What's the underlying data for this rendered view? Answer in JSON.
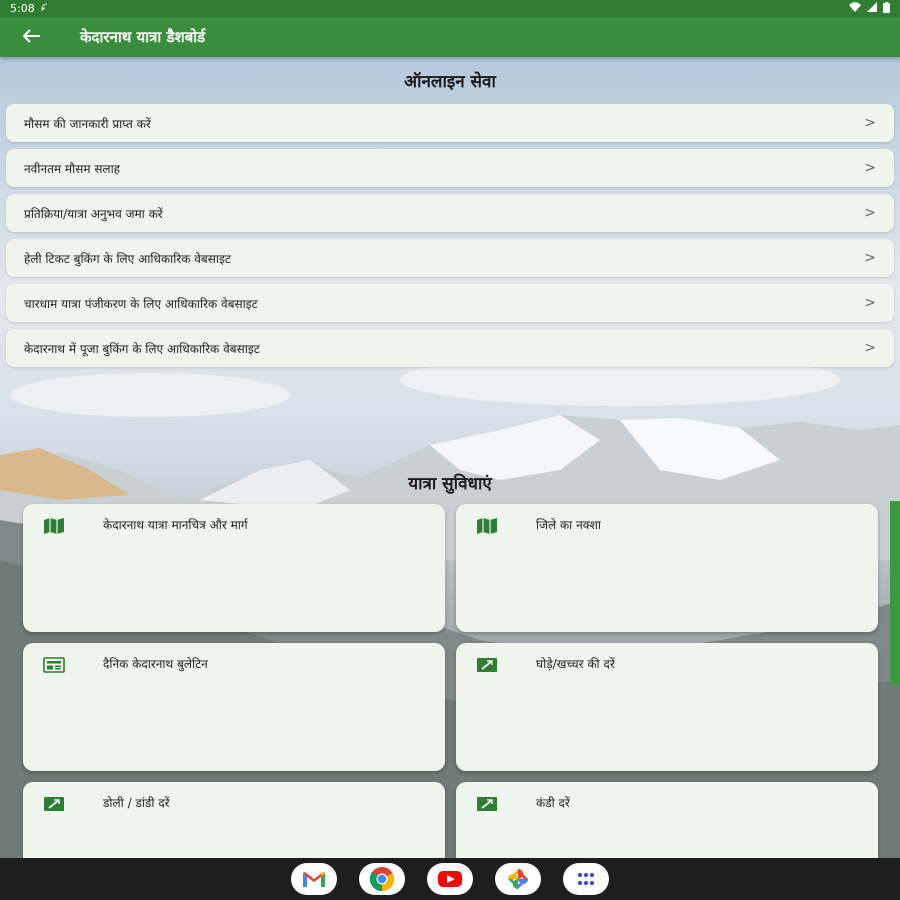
{
  "status_bar": {
    "time": "5:08"
  },
  "app_bar": {
    "title": "केदारनाथ यात्रा डैशबोर्ड"
  },
  "online_services": {
    "title": "ऑनलाइन सेवा",
    "items": [
      {
        "label": "मौसम की जानकारी प्राप्त करें"
      },
      {
        "label": "नवीनतम मौसम सलाह"
      },
      {
        "label": "प्रतिक्रिया/यात्रा अनुभव जमा करें"
      },
      {
        "label": "हेली टिकट बुकिंग के लिए आधिकारिक वेबसाइट"
      },
      {
        "label": "चारधाम यात्रा पंजीकरण के लिए आधिकारिक वेबसाइट"
      },
      {
        "label": "केदारनाथ में पूजा बुकिंग के लिए आधिकारिक वेबसाइट"
      }
    ],
    "chevron": ">"
  },
  "facilities": {
    "title": "यात्रा सुविधाएं",
    "cards": [
      {
        "label": "केदारनाथ यात्रा मानचित्र और मार्ग",
        "icon": "map-icon"
      },
      {
        "label": "जिले का नक्शा",
        "icon": "map-icon"
      },
      {
        "label": "दैनिक केदारनाथ बुलेटिन",
        "icon": "newspaper-icon"
      },
      {
        "label": "घोड़े/खच्चर की दरें",
        "icon": "money-icon"
      },
      {
        "label": "डोली / डांडी दरें",
        "icon": "money-icon"
      },
      {
        "label": "कंडी दरें",
        "icon": "money-icon"
      }
    ]
  },
  "dock": {
    "apps": [
      {
        "name": "gmail-icon"
      },
      {
        "name": "chrome-icon"
      },
      {
        "name": "youtube-icon"
      },
      {
        "name": "photos-icon"
      },
      {
        "name": "app-drawer-icon"
      }
    ]
  },
  "colors": {
    "status_bar": "#2e7d32",
    "app_bar": "#388e3c",
    "item_bg": "#eef5ec",
    "accent": "#3a9a3f"
  }
}
